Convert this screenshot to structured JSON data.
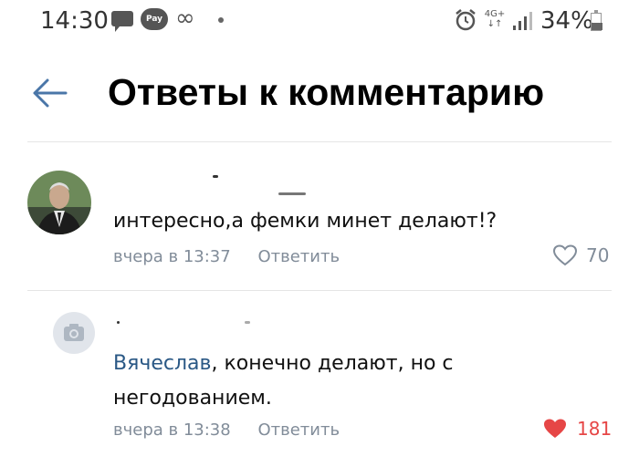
{
  "status_bar": {
    "time": "14:30",
    "pay_label": "Pay",
    "network_label": "4G+",
    "battery": "34%"
  },
  "header": {
    "title": "Ответы к комментарию"
  },
  "comments": [
    {
      "text": "интересно,а фемки минет делают!?",
      "timestamp": "вчера в 13:37",
      "reply_label": "Ответить",
      "likes": "70",
      "liked": false
    },
    {
      "mention": "Вячеслав",
      "text": ", конечно делают, но с негодованием.",
      "timestamp": "вчера в 13:38",
      "reply_label": "Ответить",
      "likes": "181",
      "liked": true
    }
  ],
  "colors": {
    "accent": "#4a76a8",
    "like_active": "#e64646",
    "meta": "#818c99"
  }
}
